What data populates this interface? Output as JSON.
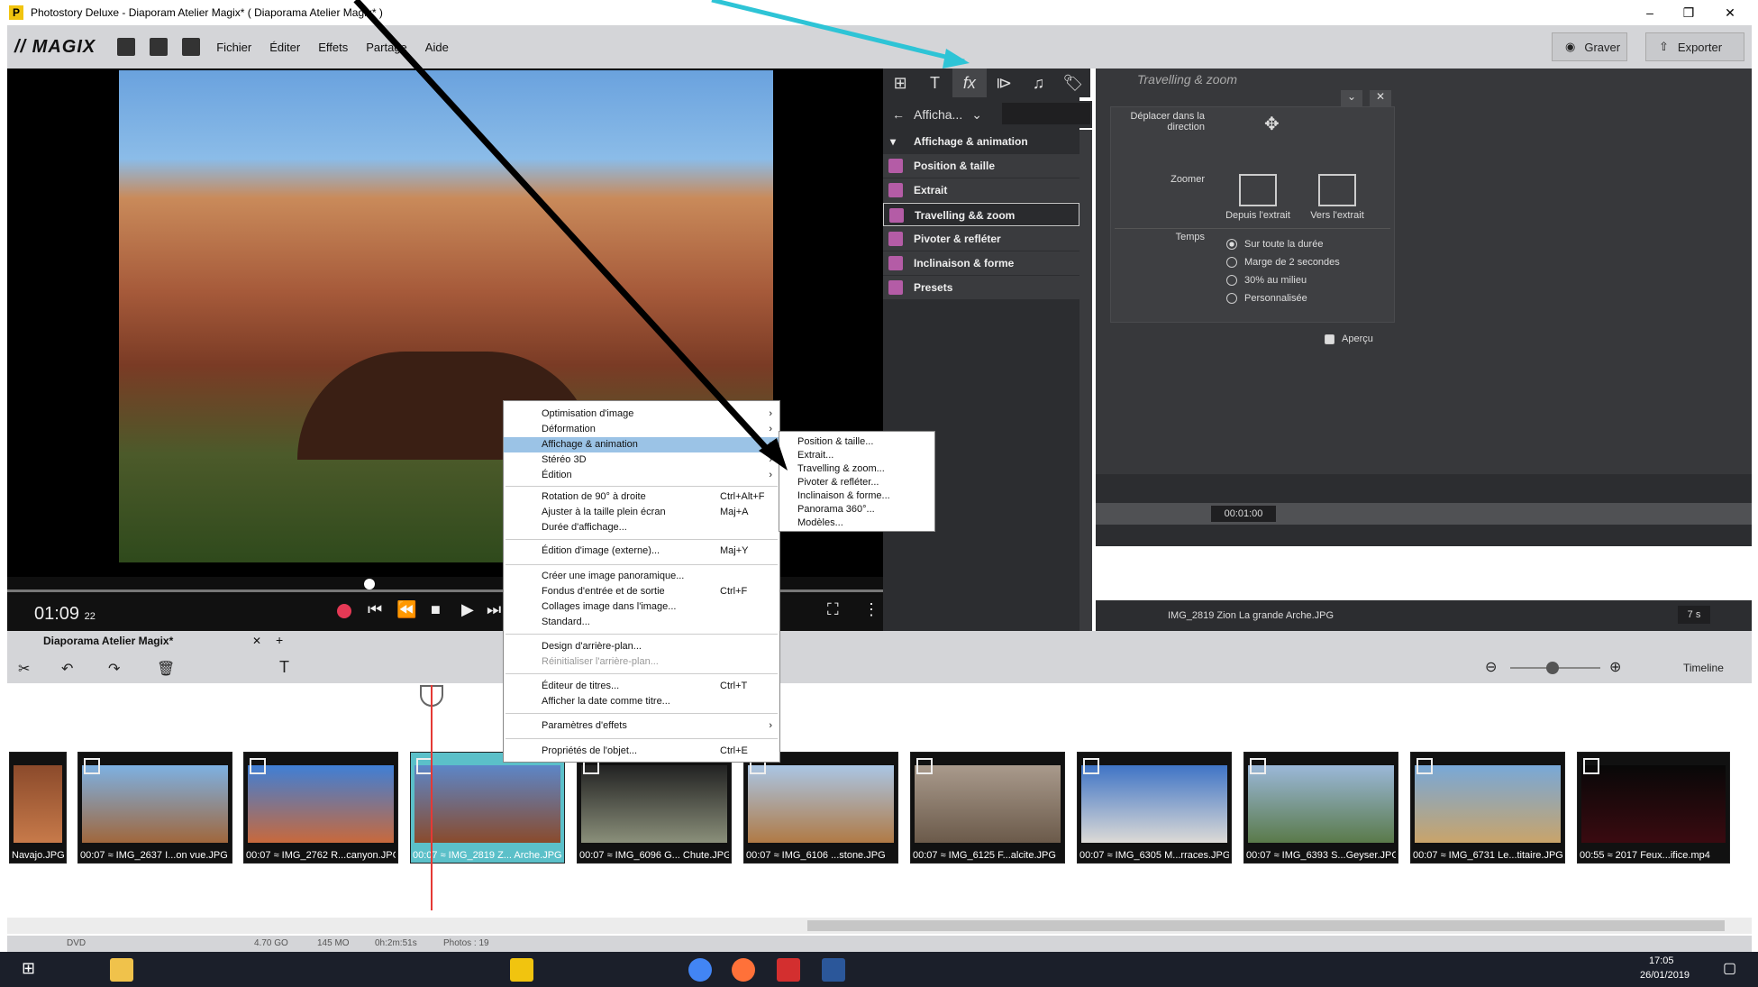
{
  "window": {
    "title": "Photostory Deluxe - Diaporam Atelier Magix* ( Diaporama Atelier Magix* )"
  },
  "menu": {
    "brand": "// MAGIX",
    "items": [
      "Fichier",
      "Éditer",
      "Effets",
      "Partage",
      "Aide"
    ],
    "burn": "Graver",
    "export": "Exporter"
  },
  "preview": {
    "timecode": "01:09",
    "frames": "22"
  },
  "fx": {
    "nav": "Afficha...",
    "items": [
      "Affichage & animation",
      "Position & taille",
      "Extrait",
      "Travelling && zoom",
      "Pivoter & refléter",
      "Inclinaison & forme",
      "Presets"
    ]
  },
  "props": {
    "title": "Travelling & zoom",
    "move_label": "Déplacer dans la direction",
    "zoom_label": "Zoomer",
    "from_label": "Depuis l'extrait",
    "to_label": "Vers l'extrait",
    "time_label": "Temps",
    "time_options": [
      "Sur toute la durée",
      "Marge de 2 secondes",
      "30% au milieu",
      "Personnalisée"
    ],
    "preview_label": "Aperçu",
    "kf_time": "00:01:00",
    "file": "IMG_2819 Zion La grande Arche.JPG",
    "duration": "7 s"
  },
  "project": {
    "tab": "Diaporama Atelier Magix*",
    "view": "Timeline"
  },
  "clips": [
    {
      "label": "Navajo.JPG"
    },
    {
      "label": "00:07 ≈ IMG_2637 I...on vue.JPG"
    },
    {
      "label": "00:07 ≈ IMG_2762 R...canyon.JPG"
    },
    {
      "label": "00:07 ≈ IMG_2819 Z... Arche.JPG"
    },
    {
      "label": "00:07 ≈ IMG_6096 G... Chute.JPG"
    },
    {
      "label": "00:07 ≈ IMG_6106 ...stone.JPG"
    },
    {
      "label": "00:07 ≈ IMG_6125 F...alcite.JPG"
    },
    {
      "label": "00:07 ≈ IMG_6305 M...rraces.JPG"
    },
    {
      "label": "00:07 ≈ IMG_6393 S...Geyser.JPG"
    },
    {
      "label": "00:07 ≈ IMG_6731 Le...titaire.JPG"
    },
    {
      "label": "00:55 ≈ 2017 Feux...ifice.mp4"
    }
  ],
  "status": {
    "disc": "DVD",
    "space": "4.70 GO",
    "used": "145 MO",
    "time": "0h:2m:51s",
    "photos": "Photos : 19"
  },
  "context": {
    "items": [
      {
        "label": "Optimisation d'image",
        "arrow": "›"
      },
      {
        "label": "Déformation",
        "arrow": "›"
      },
      {
        "label": "Affichage & animation",
        "arrow": "›"
      },
      {
        "label": "Stéréo 3D",
        "arrow": "›"
      },
      {
        "label": "Édition",
        "arrow": "›"
      },
      {
        "label": "Rotation de 90° à droite",
        "shortcut": "Ctrl+Alt+F"
      },
      {
        "label": "Ajuster à la taille plein écran",
        "shortcut": "Maj+A"
      },
      {
        "label": "Durée d'affichage..."
      },
      {
        "label": "Édition d'image (externe)...",
        "shortcut": "Maj+Y"
      },
      {
        "label": "Créer une image panoramique..."
      },
      {
        "label": "Fondus d'entrée et de sortie",
        "shortcut": "Ctrl+F"
      },
      {
        "label": "Collages image dans l'image..."
      },
      {
        "label": "Standard..."
      },
      {
        "label": "Design d'arrière-plan..."
      },
      {
        "label": "Réinitialiser l'arrière-plan..."
      },
      {
        "label": "Éditeur de titres...",
        "shortcut": "Ctrl+T"
      },
      {
        "label": "Afficher la date comme titre..."
      },
      {
        "label": "Paramètres d'effets",
        "arrow": "›"
      },
      {
        "label": "Propriétés de l'objet...",
        "shortcut": "Ctrl+E"
      }
    ],
    "submenu": [
      "Position & taille...",
      "Extrait...",
      "Travelling & zoom...",
      "Pivoter & refléter...",
      "Inclinaison & forme...",
      "Panorama 360°...",
      "Modèles..."
    ]
  },
  "taskbar": {
    "time": "17:05",
    "date": "26/01/2019"
  },
  "colors": {
    "accent": "#2ec4d6",
    "highlight": "#9bc3e6",
    "selected_clip": "#5bc0c9",
    "playhead": "#e53935"
  }
}
